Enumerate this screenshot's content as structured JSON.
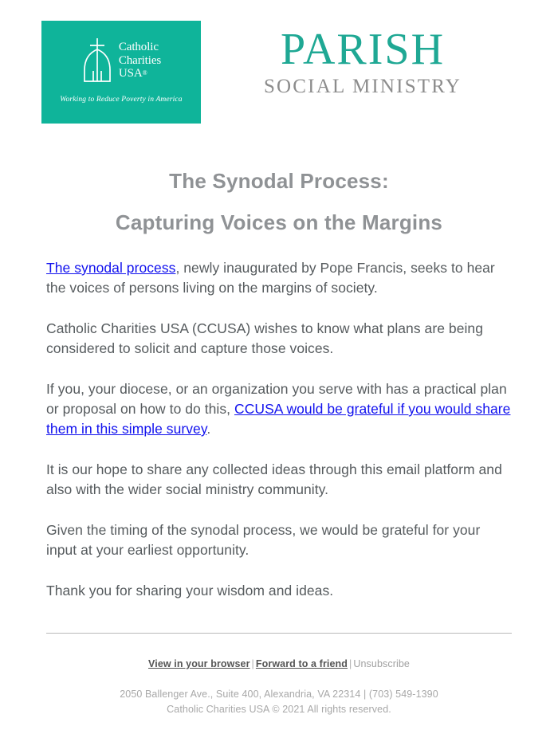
{
  "header": {
    "ccusa_logo": {
      "icon": "catholic-charities-cross-bell-mark",
      "line1": "Catholic",
      "line2": "Charities",
      "line3": "USA",
      "registered_mark": "®",
      "tagline": "Working to Reduce Poverty in America",
      "background_color": "#0fb49a"
    },
    "psm_logo": {
      "primary": "PARISH",
      "secondary": "SOCIAL MINISTRY",
      "primary_color": "#1fa894",
      "secondary_color": "#8c8c8c"
    }
  },
  "headings": {
    "line1": "The Synodal Process:",
    "line2": "Capturing Voices on the Margins",
    "color": "#8f9295"
  },
  "body": {
    "p1": {
      "link_text": "The synodal process",
      "rest": ", newly inaugurated by Pope Francis, seeks to hear the voices of persons living on the margins of society."
    },
    "p2": "Catholic Charities USA (CCUSA) wishes to know what plans are being considered to solicit and capture those voices.",
    "p3": {
      "before": "If you, your diocese, or an organization you serve with has a practical plan or proposal on how to do this, ",
      "link_text": "CCUSA would be grateful if you would share them in this simple survey",
      "after": "."
    },
    "p4": "It is our hope to share any collected ideas through this email platform and also with the wider social ministry community.",
    "p5": "Given the timing of the synodal process, we would be grateful for your input at your earliest opportunity.",
    "p6": "Thank you for sharing your wisdom and ideas.",
    "text_color": "#565b5e",
    "link_color": "#1111ee"
  },
  "footer": {
    "view_in_browser": "View in your browser",
    "separator": "|",
    "forward_to_friend": "Forward to a friend",
    "unsubscribe": "Unsubscribe",
    "address": "2050 Ballenger Ave., Suite 400, Alexandria, VA 22314 | (703) 549-1390",
    "copyright": "Catholic Charities USA © 2021 All rights reserved."
  }
}
